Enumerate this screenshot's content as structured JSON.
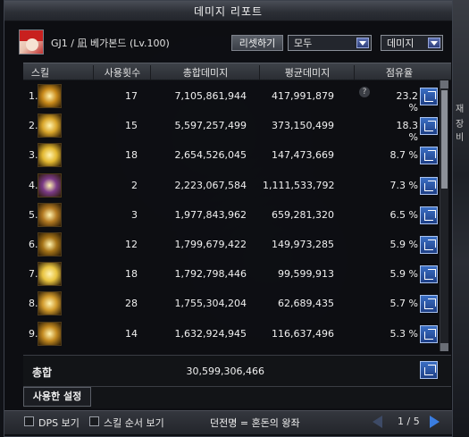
{
  "window": {
    "title": "데미지 리포트"
  },
  "right_strip": {
    "text1": "재",
    "text2": "장비"
  },
  "character": {
    "name": "GJ1 / 凪 베가본드 (Lv.100)"
  },
  "toolbar": {
    "reset_label": "리셋하기",
    "filter1_value": "모두",
    "filter2_value": "데미지"
  },
  "table": {
    "headers": [
      "스킬",
      "사용횟수",
      "총합데미지",
      "평균데미지",
      "점유율"
    ],
    "rows": [
      {
        "rank": "1.",
        "icon": "golden-spiral-skill-icon",
        "count": "17",
        "total": "7,105,861,944",
        "avg": "417,991,879",
        "pct": "23.2 %",
        "color": "#c98a1a"
      },
      {
        "rank": "2.",
        "icon": "golden-wave-skill-icon",
        "count": "15",
        "total": "5,597,257,499",
        "avg": "373,150,499",
        "pct": "18.3 %",
        "color": "#d9a52a"
      },
      {
        "rank": "3.",
        "icon": "golden-cross-skill-icon",
        "count": "18",
        "total": "2,654,526,045",
        "avg": "147,473,669",
        "pct": "8.7 %",
        "color": "#e2b730"
      },
      {
        "rank": "4.",
        "icon": "purple-warrior-skill-icon",
        "count": "2",
        "total": "2,223,067,584",
        "avg": "1,111,533,792",
        "pct": "7.3 %",
        "color": "#7a3a86"
      },
      {
        "rank": "5.",
        "icon": "golden-shield-skill-icon",
        "count": "3",
        "total": "1,977,843,962",
        "avg": "659,281,320",
        "pct": "6.5 %",
        "color": "#b37a22"
      },
      {
        "rank": "6.",
        "icon": "golden-slash-skill-icon",
        "count": "12",
        "total": "1,799,679,422",
        "avg": "149,973,285",
        "pct": "5.9 %",
        "color": "#a67418"
      },
      {
        "rank": "7.",
        "icon": "golden-burst-skill-icon",
        "count": "18",
        "total": "1,792,798,446",
        "avg": "99,599,913",
        "pct": "5.9 %",
        "color": "#e8c340"
      },
      {
        "rank": "8.",
        "icon": "golden-claw-skill-icon",
        "count": "28",
        "total": "1,755,304,204",
        "avg": "62,689,435",
        "pct": "5.7 %",
        "color": "#d19a2c"
      },
      {
        "rank": "9.",
        "icon": "golden-ring-skill-icon",
        "count": "14",
        "total": "1,632,924,945",
        "avg": "116,637,496",
        "pct": "5.3 %",
        "color": "#c38a20"
      }
    ]
  },
  "total": {
    "label": "총합",
    "value": "30,599,306,466"
  },
  "settings": {
    "tab_label": "사용한 설정"
  },
  "footer": {
    "dps_label": "DPS 보기",
    "skill_order_label": "스킬 순서 보기",
    "dungeon_text": "던전명 = 혼돈의 왕좌",
    "page_text": "1 / 5"
  }
}
